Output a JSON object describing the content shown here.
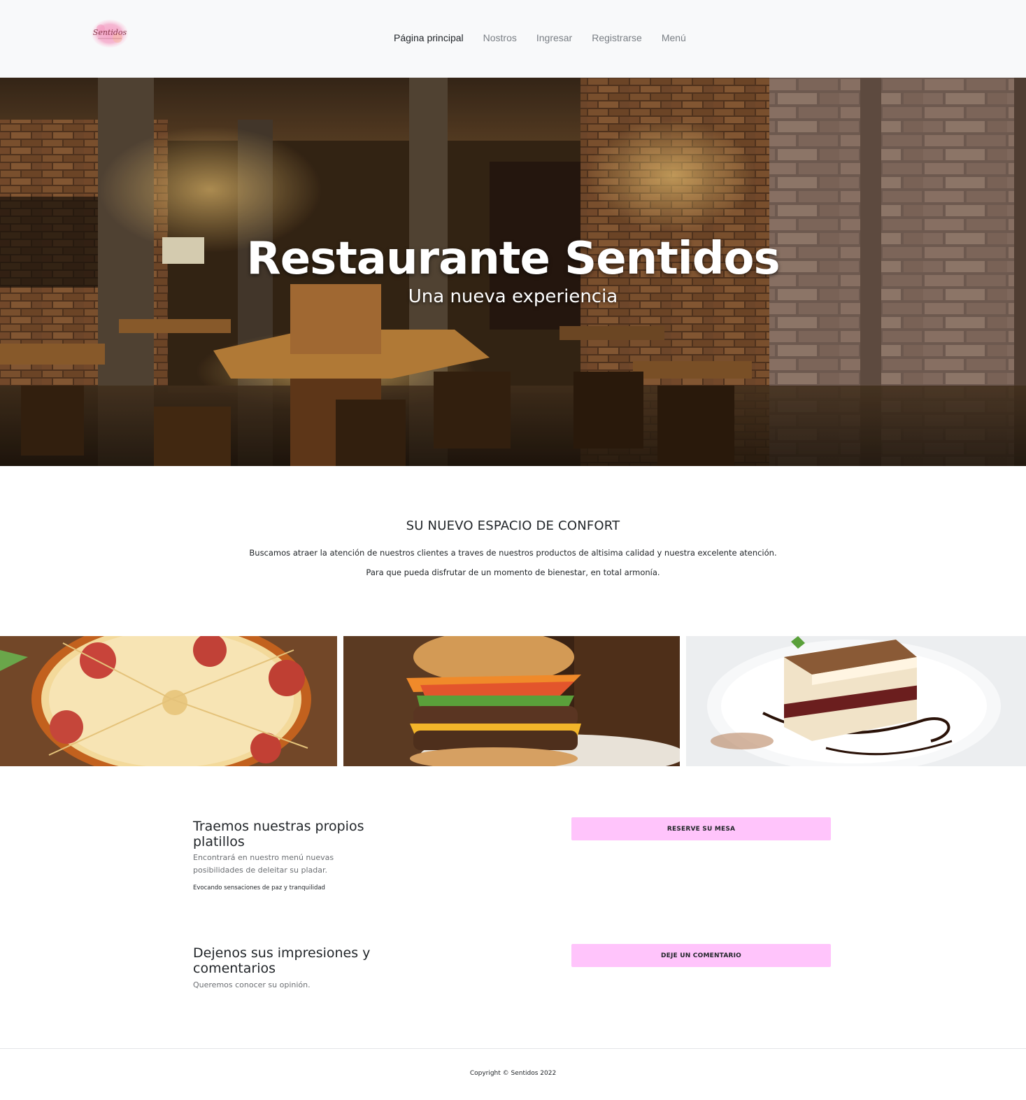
{
  "navbar": {
    "logo_text": "Sentidos",
    "links": [
      {
        "label": "Página principal"
      },
      {
        "label": "Nostros"
      },
      {
        "label": "Ingresar"
      },
      {
        "label": "Registrarse"
      },
      {
        "label": "Menú"
      }
    ]
  },
  "hero": {
    "title": "Restaurante Sentidos",
    "subtitle": "Una nueva experiencia"
  },
  "intro": {
    "heading": "SU NUEVO ESPACIO DE CONFORT",
    "paragraph1": "Buscamos atraer la atención de nuestros clientes a traves de nuestros productos de altisima calidad y nuestra excelente atención.",
    "paragraph2": "Para que pueda disfrutar de un momento de bienestar, en total armonía."
  },
  "features": [
    {
      "title": "Traemos nuestras propios platillos",
      "text": "Encontrará en nuestro menú nuevas posibilidades de deleitar su pladar.",
      "small": "Evocando sensaciones de paz y tranquilidad",
      "button": "RESERVE SU MESA"
    },
    {
      "title": "Dejenos sus impresiones y comentarios",
      "text": "Queremos conocer su opinión.",
      "small": "",
      "button": "DEJE UN COMENTARIO"
    }
  ],
  "footer": {
    "copyright": "Copyright © Sentidos 2022"
  },
  "colors": {
    "navbar_bg": "#f8f9fa",
    "button_pink": "#ffc4fb"
  }
}
